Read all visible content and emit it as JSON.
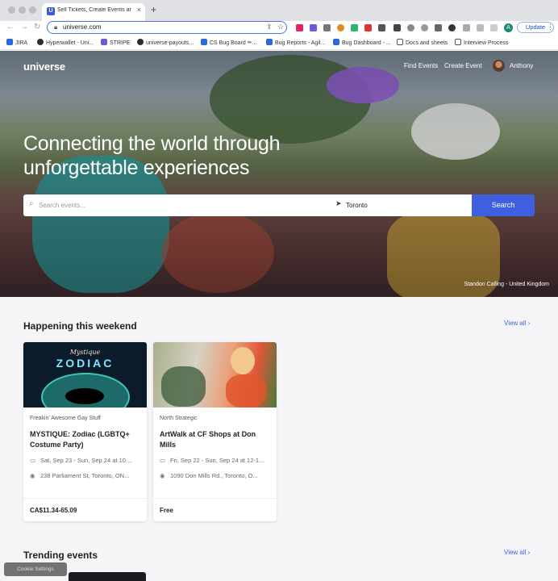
{
  "browser": {
    "tab_title": "Sell Tickets, Create Events and",
    "tab_favicon": "U",
    "url": "universe.com",
    "profile_initial": "A",
    "update_label": "Update",
    "bookmarks": [
      "JIRA",
      "Hyperwallet - Uni...",
      "STRIPE",
      "universe-payouts...",
      "CS Bug Board ✏...",
      "Bug Reports - Agil...",
      "Bug Dashboard - ...",
      "Docs and sheets",
      "Interview Process"
    ]
  },
  "header": {
    "logo": "universe",
    "nav": [
      "Find Events",
      "Create Event"
    ],
    "user_name": "Anthony"
  },
  "hero": {
    "title": "Connecting the world through unforgettable experiences",
    "search_placeholder": "Search events...",
    "location_value": "Toronto",
    "search_button": "Search",
    "photo_credit": "Standon Calling - United Kingdom"
  },
  "weekend": {
    "title": "Happening this weekend",
    "view_all": "View all",
    "cards": [
      {
        "organizer": "Freakin' Awesome Gay Stuff",
        "title": "MYSTIQUE: Zodiac (LGBTQ+ Costume Party)",
        "date": "Sat, Sep 23 - Sun, Sep 24 at 10 ...",
        "address": "238 Parliament St, Toronto, ON...",
        "price": "CA$11.34-65.09",
        "image_top": "Mystique",
        "image_main": "ZODIAC"
      },
      {
        "organizer": "North Strategic",
        "title": "ArtWalk at CF Shops at Don Mills",
        "date": "Fri, Sep 22 - Sun, Sep 24 at 12-1...",
        "address": "1090 Don Mills Rd., Toronto, O...",
        "price": "Free"
      }
    ]
  },
  "trending": {
    "title": "Trending events",
    "view_all": "View all"
  },
  "cookie_label": "Cookie Settings"
}
